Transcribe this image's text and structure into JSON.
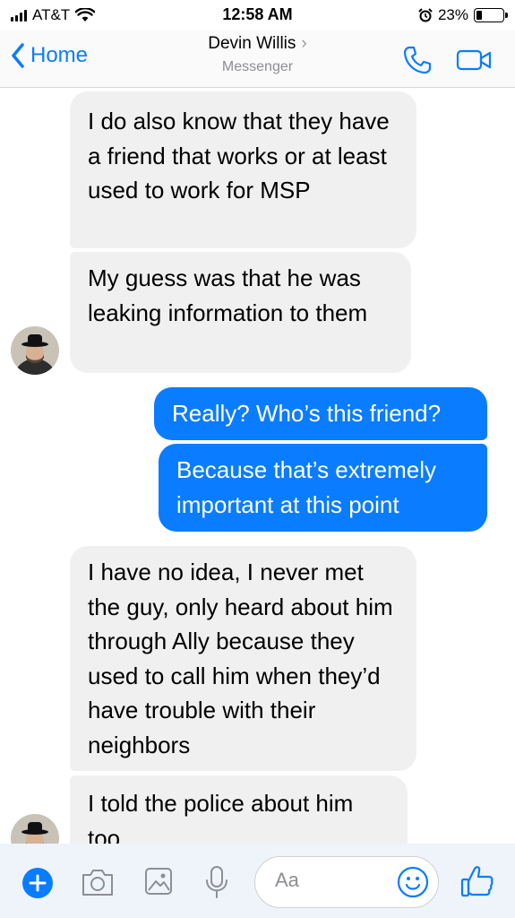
{
  "status_bar": {
    "carrier": "AT&T",
    "time": "12:58 AM",
    "battery": "23%",
    "battery_level": 0.23
  },
  "header": {
    "back_label": "Home",
    "contact_name": "Devin Willis",
    "subtitle": "Messenger"
  },
  "messages": [
    {
      "sender": "them",
      "text": "I do also know that they have a friend that works or at least used to work for MSP"
    },
    {
      "sender": "them",
      "text": "My guess was that he was leaking information to them"
    },
    {
      "sender": "me",
      "text": "Really? Who’s this friend?"
    },
    {
      "sender": "me",
      "text": "Because that’s extremely important at this point"
    },
    {
      "sender": "them",
      "text": "I have no idea, I never met the guy, only heard about him through Ally because they used to call him when they’d have trouble with their neighbors"
    },
    {
      "sender": "them",
      "text": "I told the police about him too"
    }
  ],
  "composer": {
    "placeholder": "Aa"
  },
  "colors": {
    "accent": "#0a7cff",
    "incoming_bubble": "#f1f0f0",
    "composer_bg": "#eef4fa"
  }
}
